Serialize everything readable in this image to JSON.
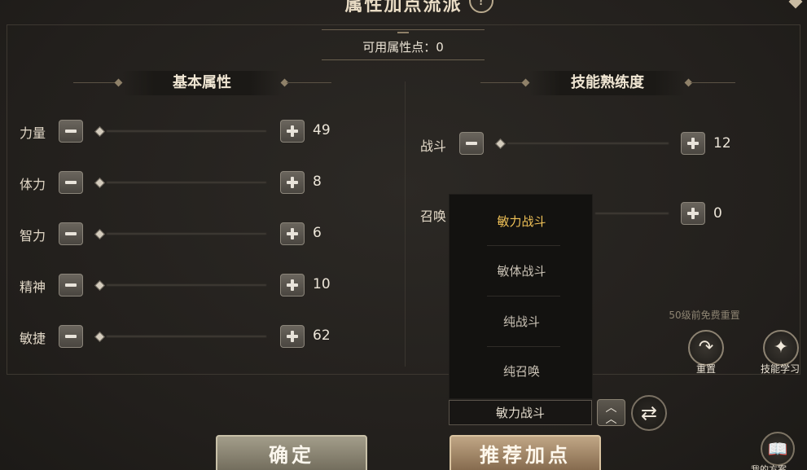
{
  "title": "属性加点流派",
  "points_label": "可用属性点：0",
  "basic": {
    "title": "基本属性",
    "stats": [
      {
        "name": "力量",
        "value": "49"
      },
      {
        "name": "体力",
        "value": "8"
      },
      {
        "name": "智力",
        "value": "6"
      },
      {
        "name": "精神",
        "value": "10"
      },
      {
        "name": "敏捷",
        "value": "62"
      }
    ]
  },
  "skill": {
    "title": "技能熟练度",
    "stats": [
      {
        "name": "战斗",
        "value": "12"
      },
      {
        "name": "召唤",
        "value": "0"
      }
    ]
  },
  "dropdown": {
    "options": [
      "敏力战斗",
      "敏体战斗",
      "纯战斗",
      "纯召唤"
    ],
    "selected": "敏力战斗"
  },
  "free_reset_note": "50级前免费重置",
  "reset_label": "重置",
  "learn_label": "技能学习",
  "confirm_label": "确定",
  "recommend_label": "推荐加点",
  "my_solution_label": "我的方案",
  "icons": {
    "help": "question-icon",
    "reset": "redo-arrow-icon",
    "learn": "flame-skill-icon",
    "refresh": "swap-arrows-icon",
    "collapse": "double-chevron-up-icon",
    "book": "book-icon"
  },
  "colors": {
    "selected_option": "#f2c358",
    "background": "#25221f"
  }
}
